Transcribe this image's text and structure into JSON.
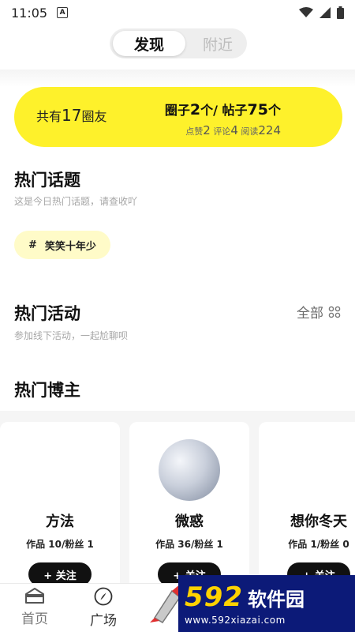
{
  "status_bar": {
    "time": "11:05",
    "notice_glyph": "A"
  },
  "segment": {
    "active": "发现",
    "inactive": "附近"
  },
  "stats": {
    "total_prefix": "共有",
    "total_count": "17",
    "total_suffix": "圈友",
    "circles_label": "圈子",
    "circles_count": "2",
    "circles_unit": "个/",
    "posts_label": "帖子",
    "posts_count": "75",
    "posts_unit": "个",
    "likes_label": "点赞",
    "likes_count": "2",
    "comments_label": "评论",
    "comments_count": "4",
    "reads_label": "阅读",
    "reads_count": "224"
  },
  "hot_topics": {
    "title": "热门话题",
    "subtitle": "这是今日热门话题，请查收吖",
    "topics": [
      {
        "hash": "#",
        "label": "笑笑十年少"
      }
    ]
  },
  "hot_events": {
    "title": "热门活动",
    "subtitle": "参加线下活动，一起尬聊呗",
    "all_label": "全部"
  },
  "hot_bloggers": {
    "title": "热门博主",
    "cards": [
      {
        "name": "方法",
        "meta": "作品 10/粉丝 1",
        "follow": "+ 关注",
        "has_avatar": false
      },
      {
        "name": "微惑",
        "meta": "作品 36/粉丝 1",
        "follow": "+ 关注",
        "has_avatar": true
      },
      {
        "name": "想你冬天",
        "meta": "作品 1/粉丝 0",
        "follow": "+ 关注",
        "has_avatar": false
      }
    ]
  },
  "bottom_nav": {
    "items": [
      {
        "label": "首页",
        "icon": "home-icon"
      },
      {
        "label": "广场",
        "icon": "compass-icon"
      }
    ]
  },
  "watermark": {
    "number": "592",
    "name": "软件园",
    "url": "www.592xiazai.com"
  },
  "colors": {
    "accent_yellow": "#fef12b",
    "chip_yellow": "#fffbc8",
    "watermark_blue": "#0c1a78"
  }
}
